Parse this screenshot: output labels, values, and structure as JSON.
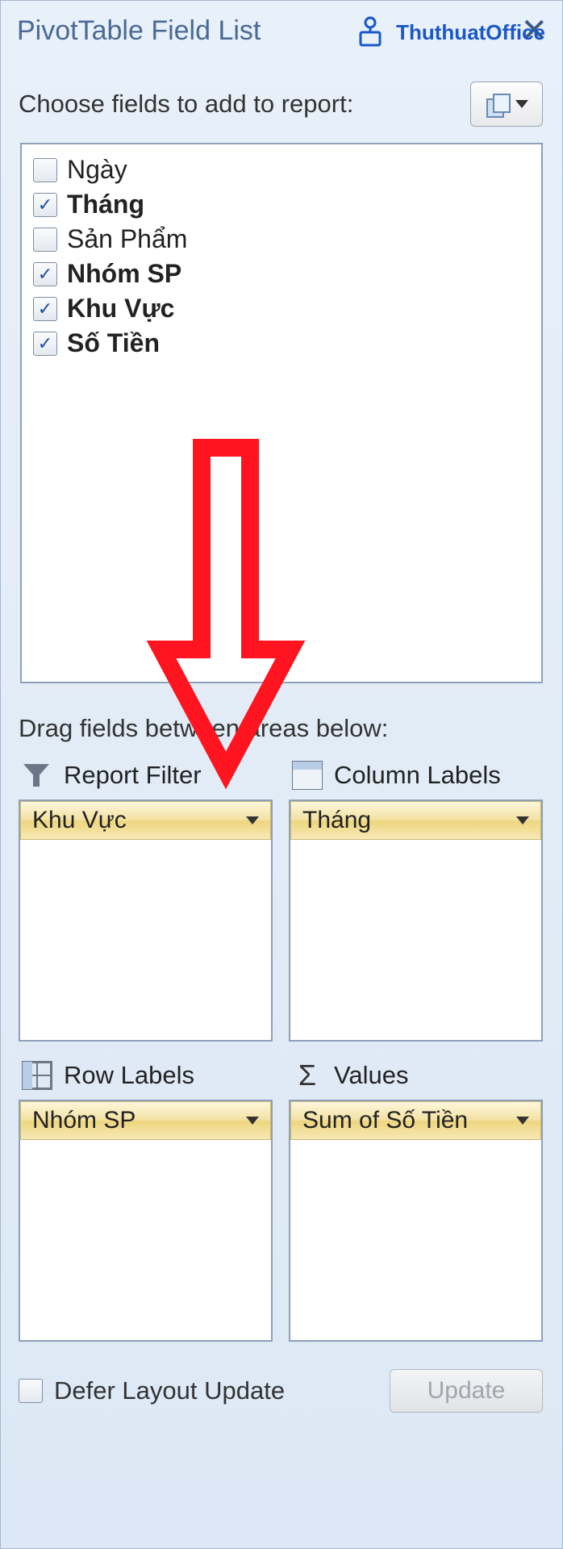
{
  "title": "PivotTable Field List",
  "choose_label": "Choose fields to add to report:",
  "fields": [
    {
      "label": "Ngày",
      "checked": false
    },
    {
      "label": "Tháng",
      "checked": true
    },
    {
      "label": "Sản Phẩm",
      "checked": false
    },
    {
      "label": "Nhóm SP",
      "checked": true
    },
    {
      "label": "Khu Vực",
      "checked": true
    },
    {
      "label": "Số Tiền",
      "checked": true
    }
  ],
  "drag_label": "Drag fields between areas below:",
  "areas": {
    "filter": {
      "label": "Report Filter",
      "items": [
        "Khu Vực"
      ]
    },
    "columns": {
      "label": "Column Labels",
      "items": [
        "Tháng"
      ]
    },
    "rows": {
      "label": "Row Labels",
      "items": [
        "Nhóm SP"
      ]
    },
    "values": {
      "label": "Values",
      "items": [
        "Sum of Số Tiền"
      ]
    }
  },
  "defer_label": "Defer Layout Update",
  "update_label": "Update",
  "watermark": "ThuthuatOffice"
}
